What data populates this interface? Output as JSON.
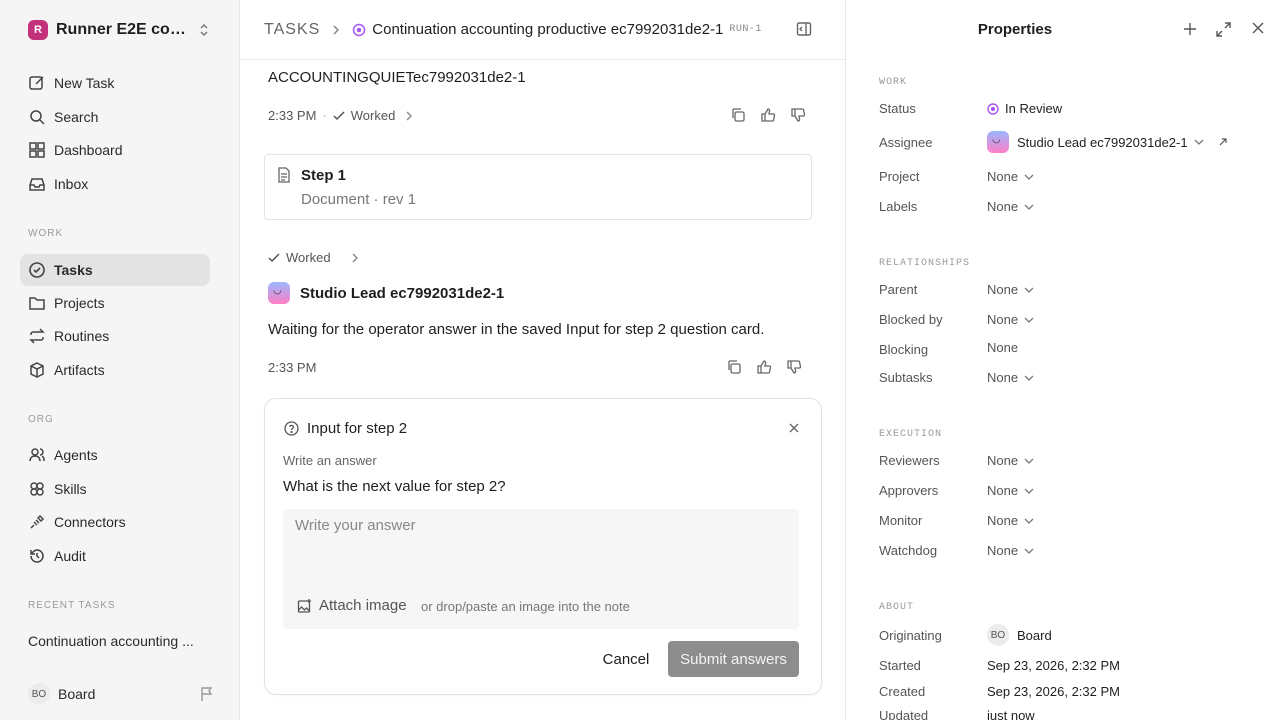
{
  "workspace": {
    "logo_letter": "R",
    "name": "Runner E2E conti...",
    "brand_color": "#c2317a"
  },
  "sidebar": {
    "top_items": [
      {
        "label": "New Task",
        "icon": "edit-icon"
      },
      {
        "label": "Search",
        "icon": "search-icon"
      },
      {
        "label": "Dashboard",
        "icon": "grid-icon"
      },
      {
        "label": "Inbox",
        "icon": "inbox-icon"
      }
    ],
    "work_section": "WORK",
    "work_items": [
      {
        "label": "Tasks",
        "icon": "check-circle-icon",
        "active": true
      },
      {
        "label": "Projects",
        "icon": "folder-icon"
      },
      {
        "label": "Routines",
        "icon": "repeat-icon"
      },
      {
        "label": "Artifacts",
        "icon": "box-icon"
      }
    ],
    "org_section": "ORG",
    "org_items": [
      {
        "label": "Agents",
        "icon": "users-icon"
      },
      {
        "label": "Skills",
        "icon": "skills-icon"
      },
      {
        "label": "Connectors",
        "icon": "plug-icon"
      },
      {
        "label": "Audit",
        "icon": "history-icon"
      }
    ],
    "recent_section": "RECENT TASKS",
    "recent_items": [
      "Continuation accounting ..."
    ],
    "user": {
      "initials": "BO",
      "name": "Board"
    }
  },
  "header": {
    "root": "TASKS",
    "title": "Continuation accounting productive ec7992031de2-1",
    "run_tag": "RUN-1"
  },
  "thread": {
    "prev_title": "ACCOUNTINGQUIETec7992031de2-1",
    "prev_time": "2:33 PM",
    "prev_status": "Worked",
    "doc": {
      "title": "Step 1",
      "subtitle": "Document · rev 1"
    },
    "worked_label": "Worked",
    "agent_name": "Studio Lead ec7992031de2-1",
    "agent_message": "Waiting for the operator answer in the saved Input for step 2 question card.",
    "agent_time": "2:33 PM"
  },
  "question_card": {
    "title": "Input for step 2",
    "label": "Write an answer",
    "question": "What is the next value for step 2?",
    "placeholder": "Write your answer",
    "attach_label": "Attach image",
    "attach_hint": "or drop/paste an image into the note",
    "cancel_label": "Cancel",
    "submit_label": "Submit answers"
  },
  "properties": {
    "title": "Properties",
    "work_section": "WORK",
    "status_label": "Status",
    "status_value": "In Review",
    "status_color": "#a855f7",
    "assignee_label": "Assignee",
    "assignee_value": "Studio Lead ec7992031de2-1",
    "project_label": "Project",
    "project_value": "None",
    "labels_label": "Labels",
    "labels_value": "None",
    "relationships_section": "RELATIONSHIPS",
    "parent_label": "Parent",
    "parent_value": "None",
    "blocked_by_label": "Blocked by",
    "blocked_by_value": "None",
    "blocking_label": "Blocking",
    "blocking_value": "None",
    "subtasks_label": "Subtasks",
    "subtasks_value": "None",
    "execution_section": "EXECUTION",
    "reviewers_label": "Reviewers",
    "reviewers_value": "None",
    "approvers_label": "Approvers",
    "approvers_value": "None",
    "monitor_label": "Monitor",
    "monitor_value": "None",
    "watchdog_label": "Watchdog",
    "watchdog_value": "None",
    "about_section": "ABOUT",
    "originating_label": "Originating",
    "originating_initials": "BO",
    "originating_value": "Board",
    "started_label": "Started",
    "started_value": "Sep 23, 2026, 2:32 PM",
    "created_label": "Created",
    "created_value": "Sep 23, 2026, 2:32 PM",
    "updated_label": "Updated",
    "updated_value": "just now"
  }
}
